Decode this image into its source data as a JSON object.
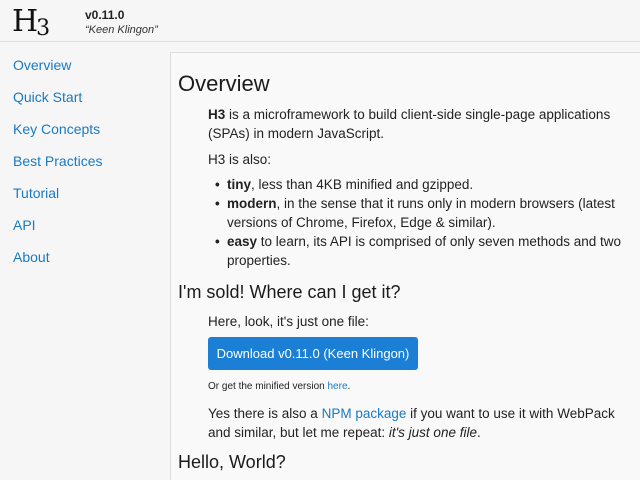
{
  "header": {
    "logo_main": "H",
    "logo_sub": "3",
    "version": "v0.11.0",
    "codename": "“Keen Klingon”"
  },
  "sidebar": {
    "items": [
      {
        "label": "Overview"
      },
      {
        "label": "Quick Start"
      },
      {
        "label": "Key Concepts"
      },
      {
        "label": "Best Practices"
      },
      {
        "label": "Tutorial"
      },
      {
        "label": "API"
      },
      {
        "label": "About"
      }
    ]
  },
  "content": {
    "title": "Overview",
    "intro_strong": "H3",
    "intro_rest": " is a microframework to build client-side single-page applications (SPAs) in modern JavaScript.",
    "also": "H3 is also:",
    "bullets": [
      {
        "strong": "tiny",
        "rest": ", less than 4KB minified and gzipped."
      },
      {
        "strong": "modern",
        "rest": ", in the sense that it runs only in modern browsers (latest versions of Chrome, Firefox, Edge & similar)."
      },
      {
        "strong": "easy",
        "rest": " to learn, its API is comprised of only seven methods and two properties."
      }
    ],
    "sold_heading": "I'm sold! Where can I get it?",
    "one_file": "Here, look, it's just one file:",
    "download_label": "Download v0.11.0 (Keen Klingon)",
    "minified_prefix": "Or get the minified version ",
    "minified_link": "here",
    "minified_suffix": ".",
    "npm_prefix": "Yes there is also a ",
    "npm_link": "NPM package",
    "npm_middle": " if you want to use it with WebPack and similar, but let me repeat: ",
    "npm_emph": "it's just one file",
    "npm_suffix": ".",
    "hello_heading": "Hello, World?"
  }
}
